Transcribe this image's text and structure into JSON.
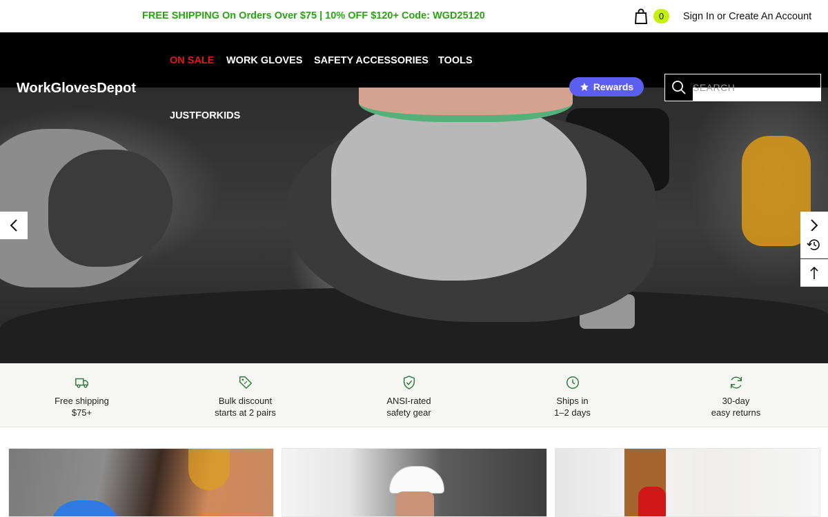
{
  "topbar": {
    "promo": "FREE SHIPPING On Orders Over $75 | 10% OFF $120+ Code: WGD25120",
    "cart_count": "0",
    "account_link": "Sign In or Create An Account"
  },
  "header": {
    "logo": "WorkGlovesDepot",
    "nav": [
      "ON SALE",
      "WORK GLOVES",
      "SAFETY ACCESSORIES",
      "TOOLS",
      "JUSTFORKIDS"
    ],
    "rewards_label": "Rewards",
    "search_placeholder": "SEARCH"
  },
  "colors": {
    "promo_green": "#2aa312",
    "sale_red": "#e51717",
    "rewards_purple": "#5b5ef0",
    "cart_badge": "#c5f007",
    "feature_icon_green": "#2f7a3f"
  },
  "features": [
    {
      "icon": "truck-icon",
      "line1": "Free shipping",
      "line2": "$75+"
    },
    {
      "icon": "tag-icon",
      "line1": "Bulk discount",
      "line2": "starts at 2 pairs"
    },
    {
      "icon": "shield-check-icon",
      "line1": "ANSI-rated",
      "line2": "safety gear"
    },
    {
      "icon": "clock-icon",
      "line1": "Ships in",
      "line2": "1–2 days"
    },
    {
      "icon": "refresh-icon",
      "line1": "30-day",
      "line2": "easy returns"
    }
  ]
}
